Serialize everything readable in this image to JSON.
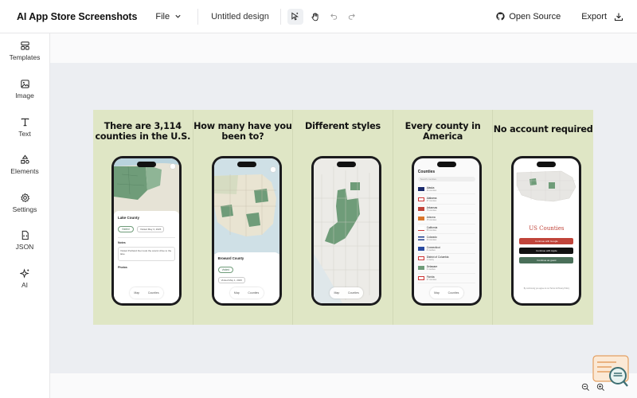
{
  "app": {
    "title": "AI App Store Screenshots"
  },
  "toolbar": {
    "file_label": "File",
    "doc_name": "Untitled design",
    "open_source_label": "Open Source",
    "export_label": "Export"
  },
  "sidebar": {
    "items": [
      {
        "label": "Templates",
        "icon": "templates-icon"
      },
      {
        "label": "Image",
        "icon": "image-icon"
      },
      {
        "label": "Text",
        "icon": "text-icon"
      },
      {
        "label": "Elements",
        "icon": "elements-icon"
      },
      {
        "label": "Settings",
        "icon": "settings-icon"
      },
      {
        "label": "JSON",
        "icon": "json-icon"
      },
      {
        "label": "AI",
        "icon": "ai-sparkle-icon"
      }
    ]
  },
  "colors": {
    "artboard_bg": "#dfe6c5",
    "map_green": "#6f9c79",
    "brand_red": "#c0443a",
    "dark_green": "#4a6f59"
  },
  "panels": [
    {
      "heading": "There are  3,114 counties in the U.S.",
      "screen": {
        "card_title": "Lake County",
        "chip": "Visited",
        "date": "Visited May 3, 2026",
        "notes_label": "Notes",
        "notes_text": "Visited Portland then took the scenic drive to the lake.",
        "photos_label": "Photos",
        "tabs": [
          "Map",
          "Counties"
        ]
      }
    },
    {
      "heading": "How many have you been to?",
      "screen": {
        "card_title": "Broward County",
        "chip": "Visited",
        "date": "Visited May 1, 2026",
        "tabs": [
          "Map",
          "Counties"
        ]
      }
    },
    {
      "heading": "Different styles",
      "screen": {
        "tabs": [
          "Map",
          "Counties"
        ]
      }
    },
    {
      "heading": "Every county in America",
      "screen": {
        "list_title": "Counties",
        "search_placeholder": "Search counties",
        "list": [
          {
            "name": "Alaska",
            "sub": "30 counties"
          },
          {
            "name": "Alabama",
            "sub": "67 counties"
          },
          {
            "name": "Arkansas",
            "sub": "75 counties"
          },
          {
            "name": "Arizona",
            "sub": "15 counties"
          },
          {
            "name": "California",
            "sub": "58 counties"
          },
          {
            "name": "Colorado",
            "sub": "64 counties"
          },
          {
            "name": "Connecticut",
            "sub": "8 counties"
          },
          {
            "name": "District of Columbia",
            "sub": "1 county"
          },
          {
            "name": "Delaware",
            "sub": "3 counties"
          },
          {
            "name": "Florida",
            "sub": "67 counties"
          }
        ],
        "tabs": [
          "Map",
          "Counties"
        ]
      }
    },
    {
      "heading": "No account required",
      "screen": {
        "app_name": "US Counties",
        "btn_google": "Continue with Google",
        "btn_apple": "Continue with Apple",
        "btn_guest": "Continue as guest",
        "footer": "By continuing you agree to our Terms & Privacy Policy"
      }
    }
  ]
}
